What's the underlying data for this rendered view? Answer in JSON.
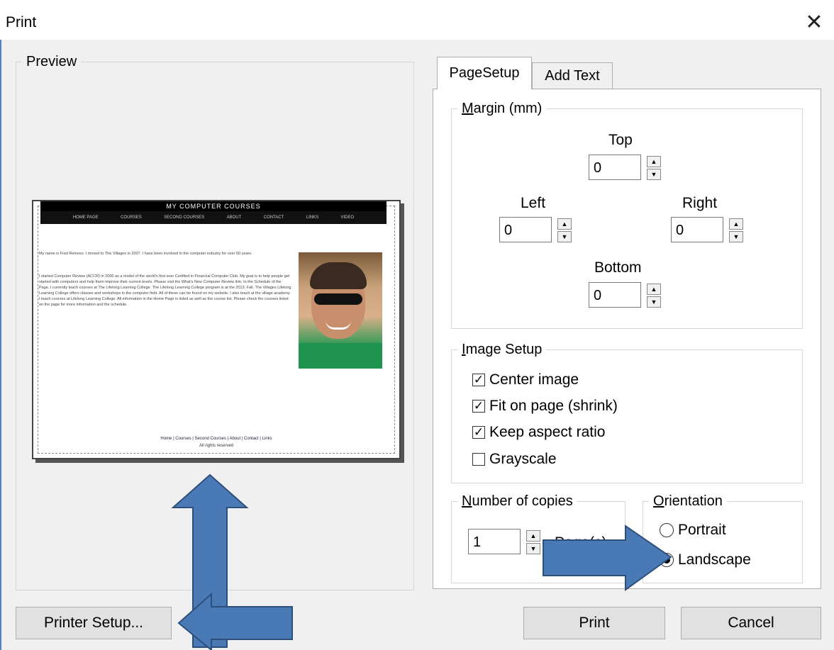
{
  "window": {
    "title": "Print",
    "close_glyph": "✕"
  },
  "preview": {
    "legend": "Preview",
    "site": {
      "banner": "MY COMPUTER COURSES",
      "nav": [
        "HOME PAGE",
        "COURSES",
        "SECOND COURSES",
        "ABOUT",
        "CONTACT",
        "LINKS",
        "VIDEO"
      ],
      "para1": "My name is Fred Reinoso. I moved to The Villages in 2007. I have been involved in the computer industry for over 50 years.",
      "para2": "I started Computer Review (ACCR) in 2000 as a model of the world's first ever Certified in Financial Computer Club. My goal is to help people get started with computers and help them improve their current levels. Please visit the What's New Computer Review link. In the Schedule of the Page. I currently teach courses at The Lifelong Learning College. The Lifelong Learning College program is at the 2013. Fall. The Villages Lifelong Learning College offers classes and workshops in the computer field. All of these can be found on my website. I also teach at the village academy. I teach courses at Lifelong Learning College. All information in the Home Page is listed as well as the course list. Please check the courses listed on the page for more information and the schedule.",
      "footer_links": "Home | Courses | Second Courses | About | Contact | Links",
      "footer_rights": "All rights reserved"
    }
  },
  "tabs": [
    {
      "label": "PageSetup",
      "active": true
    },
    {
      "label": "Add Text",
      "active": false
    }
  ],
  "margin": {
    "legend_u": "M",
    "legend_rest": "argin (mm)",
    "top_label": "Top",
    "top_value": "0",
    "left_label": "Left",
    "left_value": "0",
    "right_label": "Right",
    "right_value": "0",
    "bottom_label": "Bottom",
    "bottom_value": "0"
  },
  "image_setup": {
    "legend_u": "I",
    "legend_rest": "mage Setup",
    "options": [
      {
        "label": "Center image",
        "checked": true
      },
      {
        "label": "Fit on page (shrink)",
        "checked": true
      },
      {
        "label": "Keep aspect ratio",
        "checked": true
      },
      {
        "label": "Grayscale",
        "checked": false
      }
    ]
  },
  "copies": {
    "legend_u": "N",
    "legend_rest": "umber of copies",
    "value": "1",
    "unit": "Page(s)"
  },
  "orientation": {
    "legend_u": "O",
    "legend_rest": "rientation",
    "portrait": "Portrait",
    "landscape": "Landscape",
    "selected": "Landscape"
  },
  "buttons": {
    "printer_setup": "Printer Setup...",
    "print": "Print",
    "cancel": "Cancel"
  },
  "colors": {
    "arrow_fill": "#4a7ab5",
    "arrow_stroke": "#2d4f7c",
    "window_border": "#4f86c6"
  },
  "icons": {
    "check": "☑",
    "spin_up": "▲",
    "spin_down": "▼"
  }
}
